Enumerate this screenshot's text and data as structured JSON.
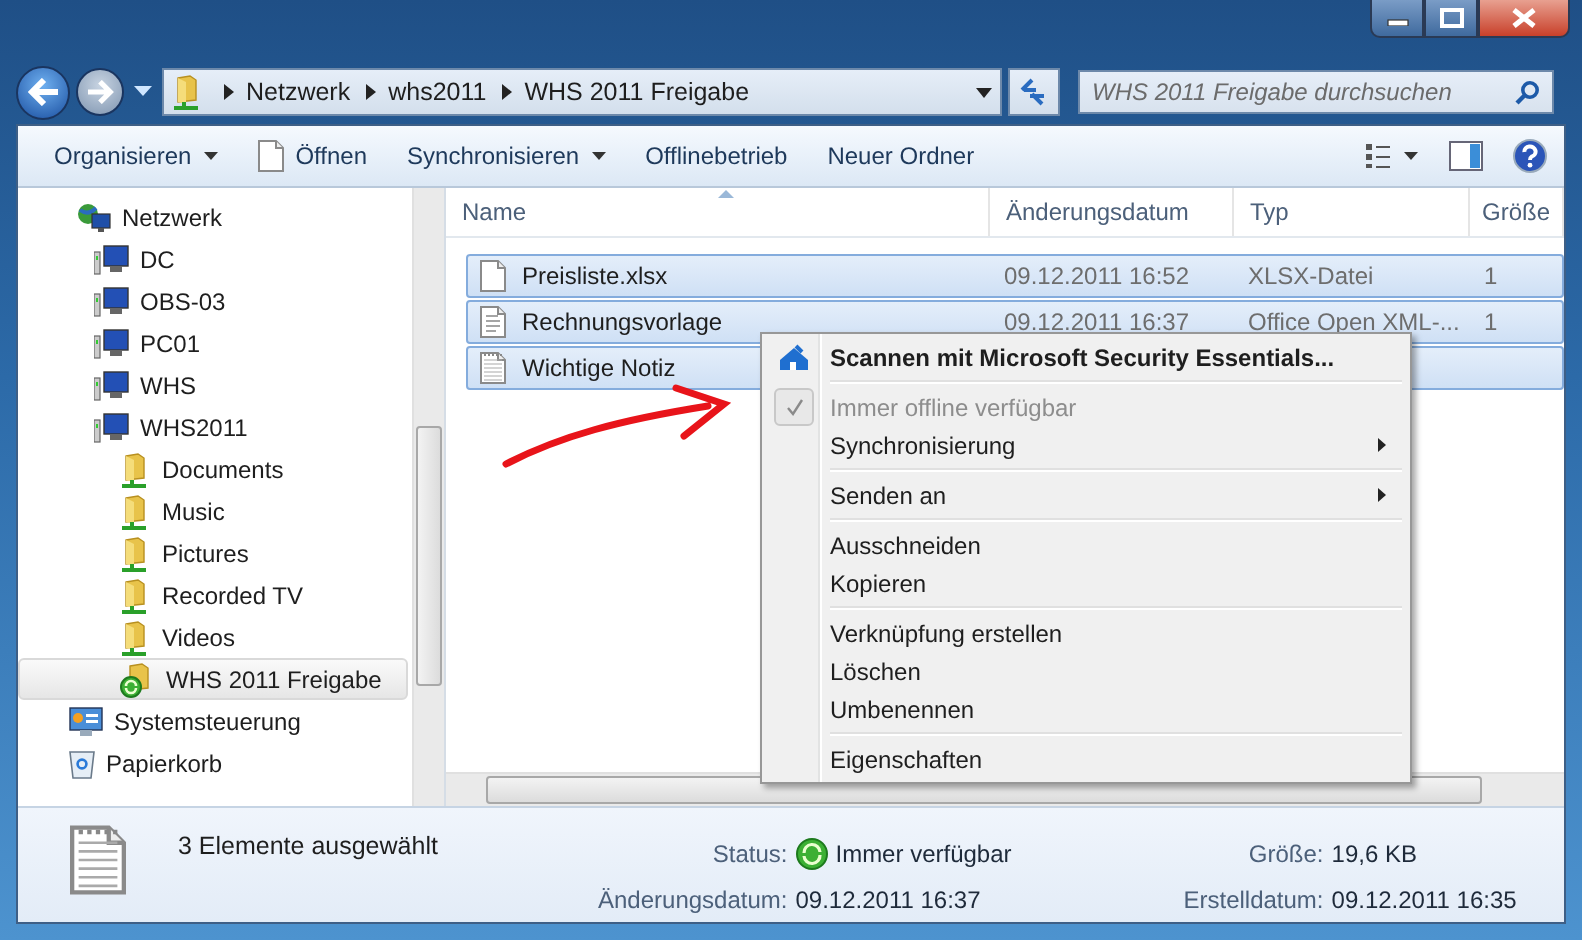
{
  "address": {
    "crumbs": [
      "Netzwerk",
      "whs2011",
      "WHS 2011 Freigabe"
    ]
  },
  "search": {
    "placeholder": "WHS 2011 Freigabe durchsuchen"
  },
  "toolbar": [
    {
      "label": "Organisieren",
      "kind": "dropdown"
    },
    {
      "label": "Öffnen",
      "kind": "file"
    },
    {
      "label": "Synchronisieren",
      "kind": "dropdown"
    },
    {
      "label": "Offlinebetrieb",
      "kind": "plain"
    },
    {
      "label": "Neuer Ordner",
      "kind": "plain"
    }
  ],
  "tree": [
    {
      "label": "Netzwerk",
      "kind": "network",
      "selected": false,
      "children": [
        {
          "label": "DC",
          "kind": "computer",
          "selected": false
        },
        {
          "label": "OBS-03",
          "kind": "computer",
          "selected": false
        },
        {
          "label": "PC01",
          "kind": "computer",
          "selected": false
        },
        {
          "label": "WHS",
          "kind": "computer",
          "selected": false
        },
        {
          "label": "WHS2011",
          "kind": "computer",
          "selected": false,
          "children": [
            {
              "label": "Documents",
              "kind": "share",
              "selected": false
            },
            {
              "label": "Music",
              "kind": "share",
              "selected": false
            },
            {
              "label": "Pictures",
              "kind": "share",
              "selected": false
            },
            {
              "label": "Recorded TV",
              "kind": "share",
              "selected": false
            },
            {
              "label": "Videos",
              "kind": "share",
              "selected": false
            },
            {
              "label": "WHS 2011 Freigabe",
              "kind": "synced-share",
              "selected": true
            }
          ]
        }
      ]
    },
    {
      "label": "Systemsteuerung",
      "kind": "control-panel",
      "selected": false
    },
    {
      "label": "Papierkorb",
      "kind": "recycle-bin",
      "selected": false
    }
  ],
  "table": {
    "columns": [
      "Name",
      "Änderungsdatum",
      "Typ",
      "Größe"
    ],
    "rows": [
      {
        "kind": "blank",
        "selected": true,
        "cells": [
          "Preisliste.xlsx",
          "09.12.2011 16:52",
          "XLSX-Datei",
          "1"
        ]
      },
      {
        "kind": "document",
        "selected": true,
        "cells": [
          "Rechnungsvorlage",
          "09.12.2011 16:37",
          "Office Open XML-...",
          "1"
        ]
      },
      {
        "kind": "text",
        "selected": true,
        "cells": [
          "Wichtige Notiz"
        ]
      }
    ]
  },
  "context_menu": {
    "groups": [
      [
        {
          "label": "Scannen mit Microsoft Security Essentials...",
          "kind": "default"
        }
      ],
      [
        {
          "label": "Immer offline verfügbar",
          "kind": "check",
          "checked": true,
          "disabled": true
        },
        {
          "label": "Synchronisierung",
          "kind": "submenu"
        }
      ],
      [
        {
          "label": "Senden an",
          "kind": "submenu"
        }
      ],
      [
        {
          "label": "Ausschneiden",
          "kind": "command"
        },
        {
          "label": "Kopieren",
          "kind": "command"
        }
      ],
      [
        {
          "label": "Verknüpfung erstellen",
          "kind": "command"
        },
        {
          "label": "Löschen",
          "kind": "command"
        },
        {
          "label": "Umbenennen",
          "kind": "command"
        }
      ],
      [
        {
          "label": "Eigenschaften",
          "kind": "command"
        }
      ]
    ]
  },
  "details": {
    "summary": "3 Elemente ausgewählt",
    "properties": [
      {
        "label": "Status:",
        "value": "Immer verfügbar",
        "kind": "status"
      },
      {
        "label": "Größe:",
        "value": "19,6 KB",
        "kind": "plain"
      },
      {
        "label": "Änderungsdatum:",
        "value": "09.12.2011 16:37",
        "kind": "plain"
      },
      {
        "label": "Erstelldatum:",
        "value": "09.12.2011 16:35",
        "kind": "plain"
      }
    ]
  }
}
